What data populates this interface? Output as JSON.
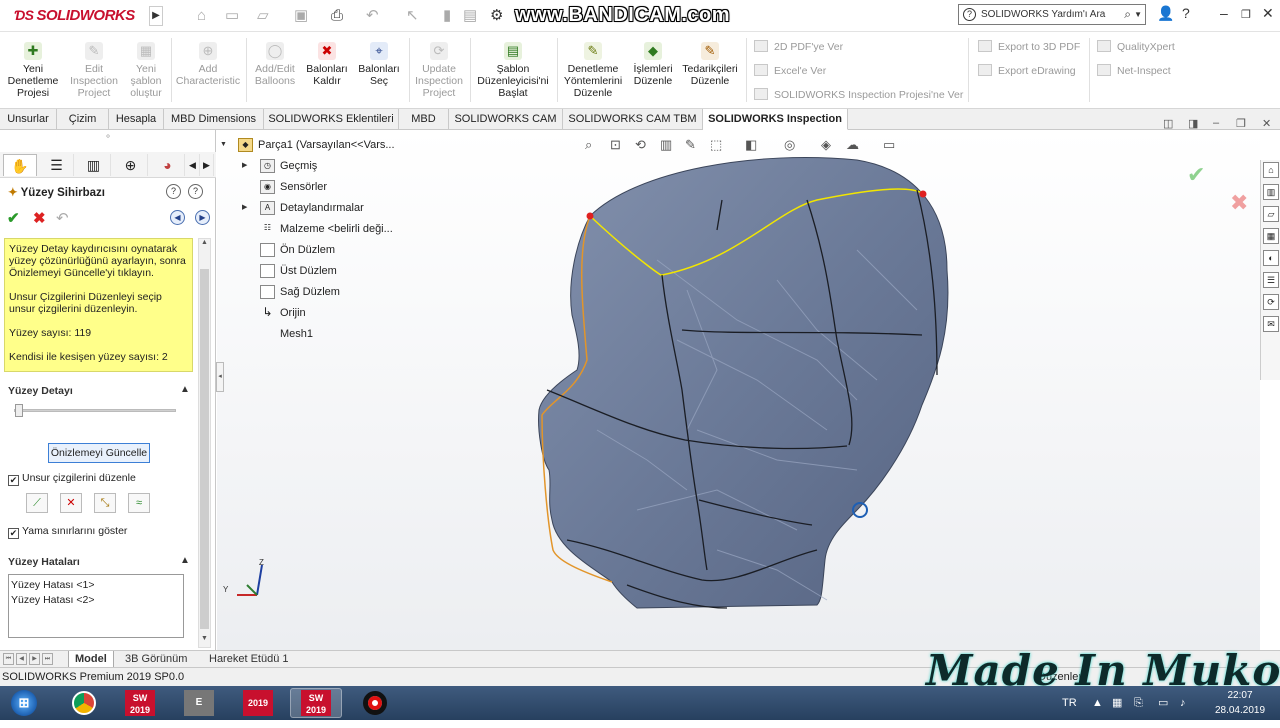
{
  "app": {
    "logo_text": "SOLIDWORKS",
    "help_search": "SOLIDWORKS Yardım'ı Ara",
    "watermark": "www.BANDICAM.com"
  },
  "ribbon": {
    "buttons": [
      {
        "label": "Yeni Denetleme Projesi",
        "enabled": true
      },
      {
        "label": "Edit Inspection Project",
        "enabled": false
      },
      {
        "label": "Yeni şablon oluştur",
        "enabled": false
      },
      {
        "label": "Add Characteristic",
        "enabled": false
      },
      {
        "label": "Add/Edit Balloons",
        "enabled": false
      },
      {
        "label": "Balonları Kaldır",
        "enabled": true
      },
      {
        "label": "Balonları Seç",
        "enabled": true
      },
      {
        "label": "Update Inspection Project",
        "enabled": false
      },
      {
        "label": "Şablon Düzenleyicisi'ni Başlat",
        "enabled": true
      },
      {
        "label": "Denetleme Yöntemlerini Düzenle",
        "enabled": true
      },
      {
        "label": "İşlemleri Düzenle",
        "enabled": true
      },
      {
        "label": "Tedarikçileri Düzenle",
        "enabled": true
      }
    ],
    "small_items": [
      "2D PDF'ye Ver",
      "Excel'e Ver",
      "SOLIDWORKS Inspection Projesi'ne Ver",
      "Export to 3D PDF",
      "Export eDrawing",
      "QualityXpert",
      "Net-Inspect"
    ]
  },
  "tabs": [
    "Unsurlar",
    "Çizim",
    "Hesapla",
    "MBD Dimensions",
    "SOLIDWORKS Eklentileri",
    "MBD",
    "SOLIDWORKS CAM",
    "SOLIDWORKS CAM TBM",
    "SOLIDWORKS Inspection"
  ],
  "active_tab": "SOLIDWORKS Inspection",
  "property_manager": {
    "title": "Yüzey Sihirbazı",
    "message_lines": [
      "Yüzey Detay kaydırıcısını oynatarak yüzey çözünürlüğünü ayarlayın, sonra Önizlemeyi Güncelle'yi tıklayın.",
      "Unsur Çizgilerini Düzenleyi seçip unsur çizgilerini düzenleyin.",
      "Yüzey sayısı: 119",
      "Kendisi ile kesişen yüzey sayısı: 2"
    ],
    "detail_group": "Yüzey Detayı",
    "detail_level": 0,
    "preview_button": "Önizlemeyi Güncelle",
    "edit_feature_lines": {
      "label": "Unsur çizgilerini düzenle",
      "checked": true
    },
    "show_patch_bounds": {
      "label": "Yama sınırlarını göster",
      "checked": true
    },
    "errors_group": "Yüzey Hataları",
    "errors": [
      "Yüzey Hatası <1>",
      "Yüzey Hatası <2>"
    ]
  },
  "feature_tree": {
    "root": "Parça1  (Varsayılan<<Vars...",
    "items": [
      "Geçmiş",
      "Sensörler",
      "Detaylandırmalar",
      "Malzeme <belirli deği...",
      "Ön Düzlem",
      "Üst Düzlem",
      "Sağ Düzlem",
      "Orijin",
      "Mesh1"
    ]
  },
  "bottom_tabs": [
    "Model",
    "3B Görünüm",
    "Hareket Etüdü 1"
  ],
  "active_bottom_tab": "Model",
  "status": {
    "left": "SOLIDWORKS Premium 2019 SP0.0",
    "right": "Düzenlem"
  },
  "taskbar": {
    "icons": [
      "windows-start-icon",
      "chrome-icon",
      "solidworks-2019-icon",
      "edrawings-icon",
      "solidworks-2019-icon",
      "solidworks-2019-icon",
      "bandicam-record-icon"
    ],
    "labels": [
      "2019",
      "E",
      "2019",
      "2019"
    ],
    "lang": "TR",
    "time": "22:07",
    "date": "28.04.2019"
  },
  "overlay_text": "Made In Muko",
  "colors": {
    "accent": "#c8102e",
    "message_bg": "#ffff8a",
    "selection_yellow": "#f2e600",
    "model_blue": "#6f7f9c"
  }
}
